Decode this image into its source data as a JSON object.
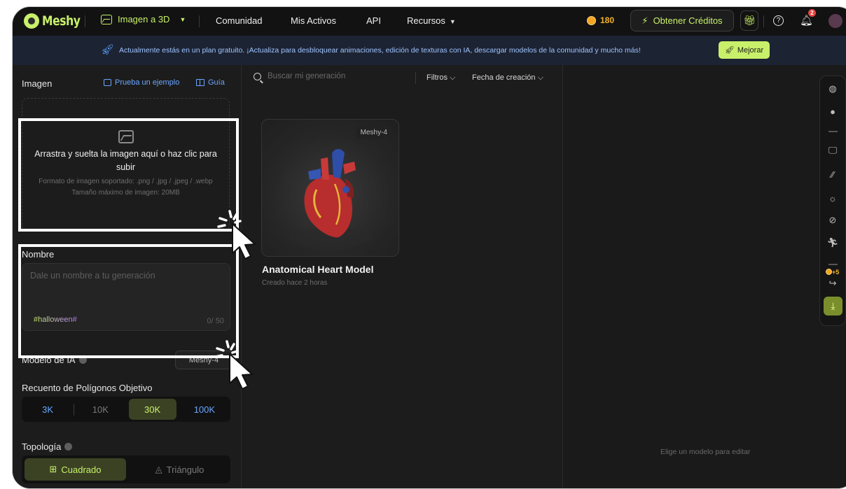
{
  "nav": {
    "logo": "Meshy",
    "mode": "Imagen a 3D",
    "links": [
      "Comunidad",
      "Mis Activos",
      "API",
      "Recursos"
    ],
    "credits": "180",
    "get_credits": "Obtener Créditos",
    "notification_count": "2"
  },
  "banner": {
    "text": "Actualmente estás en un plan gratuito. ¡Actualiza para desbloquear animaciones, edición de texturas con IA, descargar modelos de la comunidad y mucho más!",
    "button": "Mejorar"
  },
  "left": {
    "image_label": "Imagen",
    "try_example": "Prueba un ejemplo",
    "guide": "Guía",
    "drop_main": "Arrastra y suelta la imagen aquí o haz clic para subir",
    "drop_formats": "Formato de imagen soportado: .png / .jpg / .jpeg / .webp",
    "drop_size": "Tamaño máximo de imagen: 20MB",
    "name_label": "Nombre",
    "name_placeholder": "Dale un nombre a tu generación",
    "hashtag": "#halloween#",
    "counter": "0/ 50",
    "ai_model_label": "Modelo de IA",
    "ai_model_value": "Meshy-4",
    "polycount_label": "Recuento de Polígonos Objetivo",
    "polycount_options": [
      "3K",
      "10K",
      "30K",
      "100K"
    ],
    "polycount_selected": "30K",
    "topology_label": "Topología",
    "topology_options": [
      "Cuadrado",
      "Triángulo"
    ]
  },
  "middle": {
    "search_placeholder": "Buscar mi generación",
    "filters": "Filtros",
    "sort": "Fecha de creación",
    "card": {
      "badge": "Meshy-4",
      "title": "Anatomical Heart Model",
      "subtitle": "Creado hace 2 horas"
    }
  },
  "right": {
    "empty_message": "Elige un modelo para editar",
    "plus_credits": "+5"
  },
  "colors": {
    "accent": "#c8f06a",
    "link": "#6aa6ff",
    "coin": "#f2a522"
  }
}
